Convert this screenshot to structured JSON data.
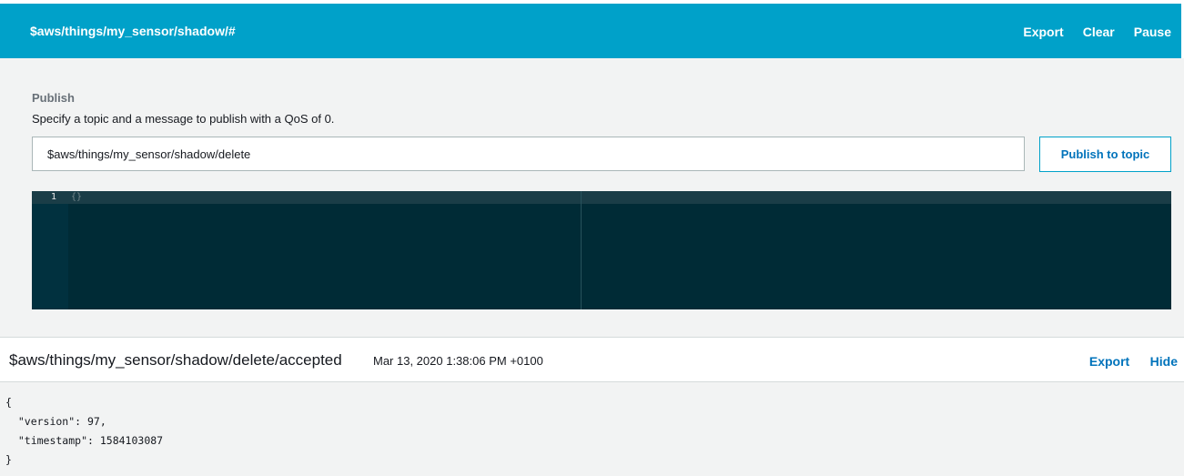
{
  "subscription": {
    "topic": "$aws/things/my_sensor/shadow/#",
    "actions": [
      "Export",
      "Clear",
      "Pause"
    ]
  },
  "publish": {
    "heading": "Publish",
    "description": "Specify a topic and a message to publish with a QoS of 0.",
    "topic_value": "$aws/things/my_sensor/shadow/delete",
    "button_label": "Publish to topic",
    "editor": {
      "line_number": "1",
      "content": "{}"
    }
  },
  "message": {
    "topic": "$aws/things/my_sensor/shadow/delete/accepted",
    "timestamp": "Mar 13, 2020 1:38:06 PM +0100",
    "export_label": "Export",
    "hide_label": "Hide",
    "payload": "{\n  \"version\": 97,\n  \"timestamp\": 1584103087\n}"
  },
  "colors": {
    "header_bg": "#00a1c9",
    "link": "#0073bb",
    "editor_bg": "#002b36",
    "panel_bg": "#f2f3f3"
  }
}
